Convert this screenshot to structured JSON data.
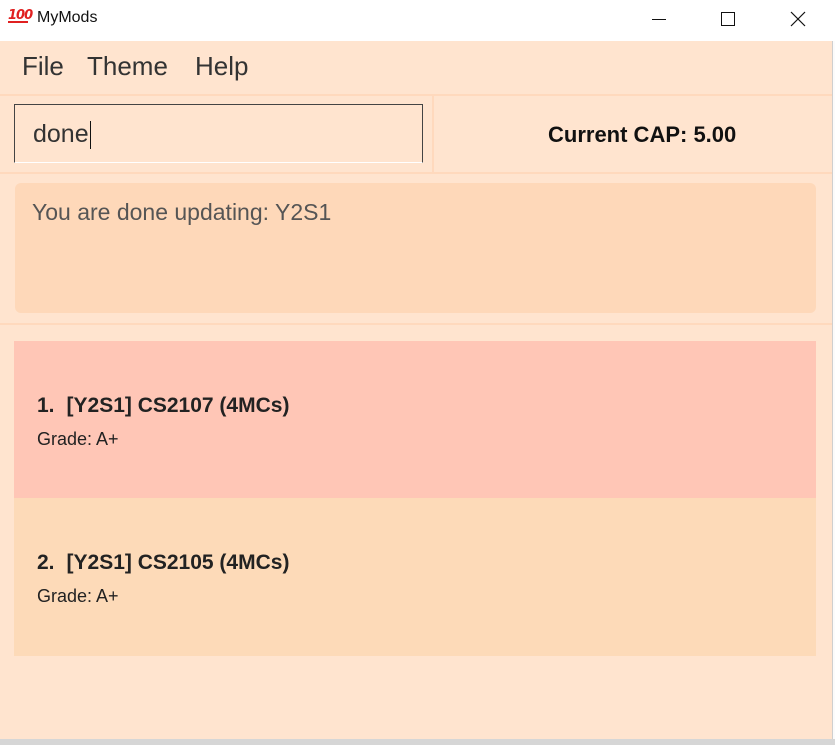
{
  "window": {
    "title": "MyMods",
    "icon": "hundred-points-emoji",
    "icon_text": "100"
  },
  "menu": {
    "items": [
      {
        "label": "File"
      },
      {
        "label": "Theme"
      },
      {
        "label": "Help"
      }
    ]
  },
  "command": {
    "value": "done"
  },
  "cap": {
    "label": "Current CAP: 5.00"
  },
  "result": {
    "message": "You are done updating: Y2S1"
  },
  "modules": [
    {
      "index": "1.",
      "title": "[Y2S1] CS2107 (4MCs)",
      "grade": "Grade: A+"
    },
    {
      "index": "2.",
      "title": "[Y2S1] CS2105 (4MCs)",
      "grade": "Grade: A+"
    }
  ],
  "colors": {
    "background": "#ffe4cf",
    "result_box": "#fed8b9",
    "selected_card": "#ffc6b6",
    "card": "#fddab8"
  }
}
